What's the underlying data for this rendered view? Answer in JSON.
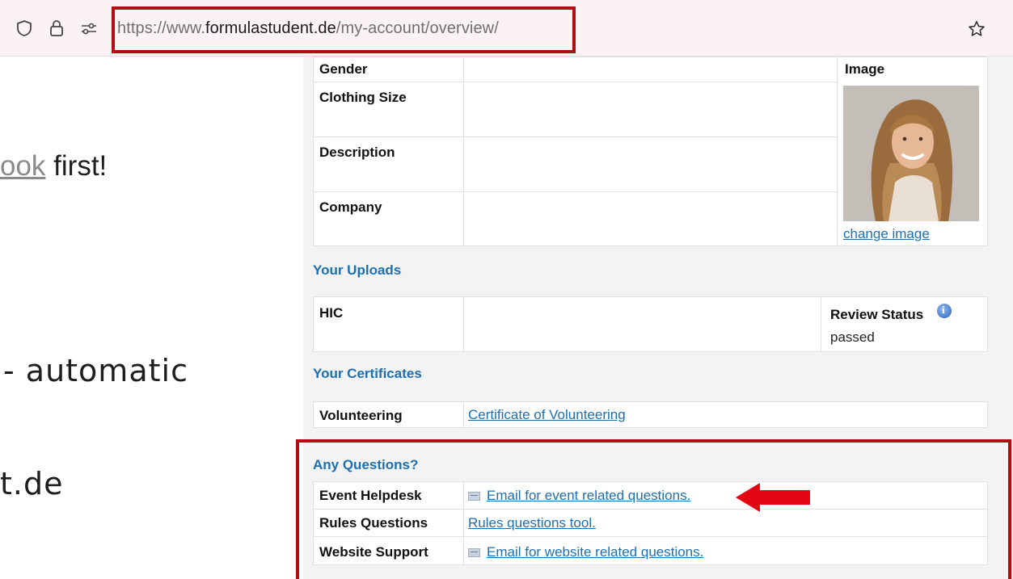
{
  "browser": {
    "url_prefix": "https://www.",
    "url_domain": "formulastudent.de",
    "url_path": "/my-account/overview/"
  },
  "slide": {
    "line1_link": "ook",
    "line1_rest": " first!",
    "line2": "- automatic",
    "line3": "t.de"
  },
  "profile": {
    "gender_label": "Gender",
    "clothing_label": "Clothing Size",
    "description_label": "Description",
    "company_label": "Company",
    "image_label": "Image",
    "change_image": "change image"
  },
  "uploads": {
    "heading": "Your Uploads",
    "hic_label": "HIC",
    "review_status_label": "Review Status",
    "review_status_value": "passed"
  },
  "certificates": {
    "heading": "Your Certificates",
    "volunteering_label": "Volunteering",
    "volunteering_link": "Certificate of Volunteering"
  },
  "questions": {
    "heading": "Any Questions?",
    "rows": [
      {
        "label": "Event Helpdesk",
        "link": "Email for event related questions.",
        "mail_icon": true
      },
      {
        "label": "Rules Questions",
        "link": "Rules questions tool.",
        "mail_icon": false
      },
      {
        "label": "Website Support",
        "link": "Email for website related questions.",
        "mail_icon": true
      }
    ]
  },
  "colors": {
    "accent_red": "#b10d12",
    "link_blue": "#1d6fb0",
    "arrow_red": "#e30613"
  }
}
